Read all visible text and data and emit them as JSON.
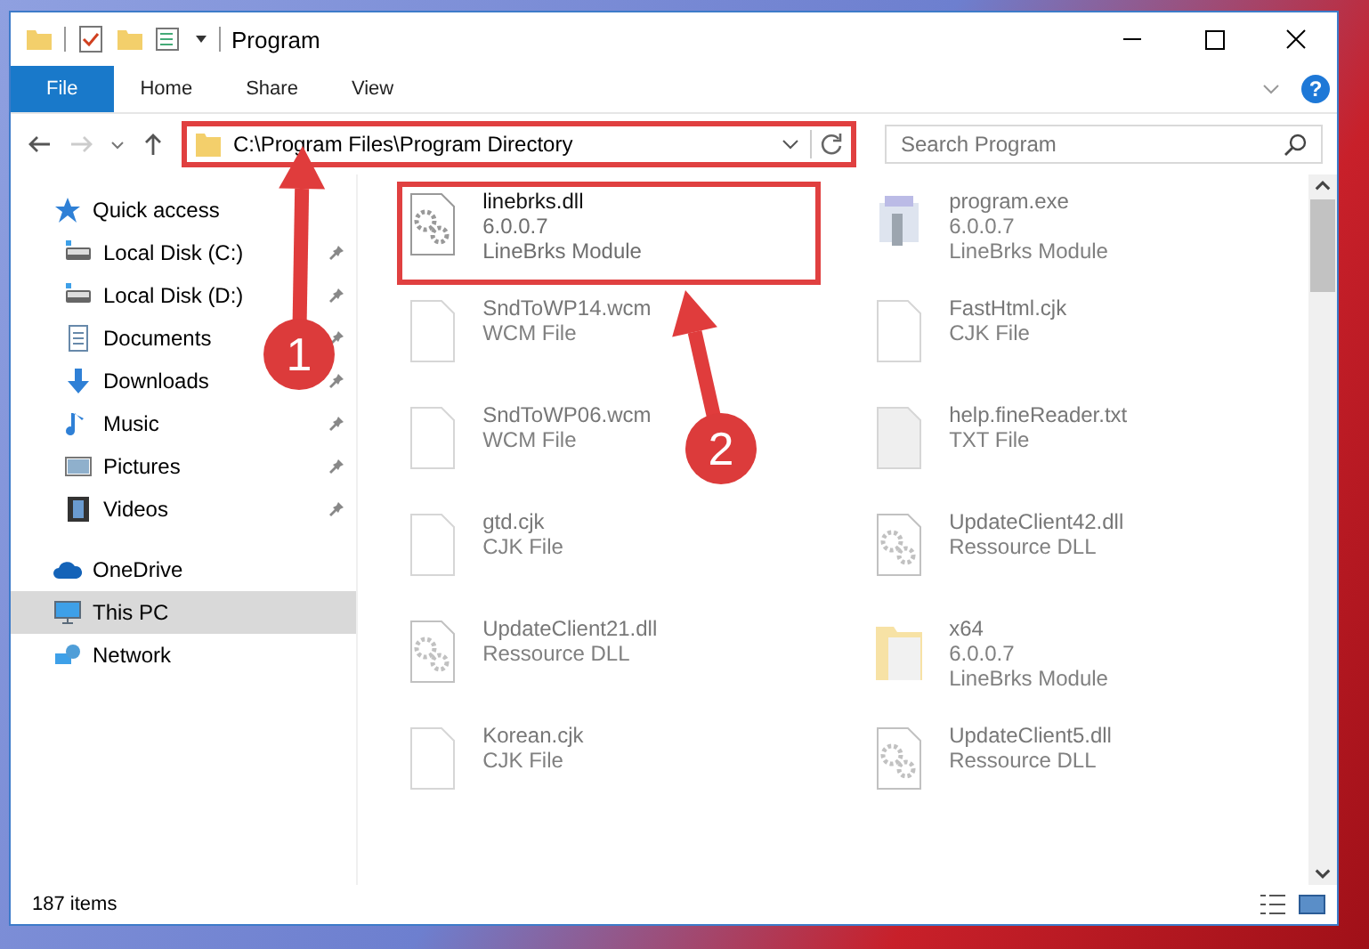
{
  "window": {
    "title": "Program"
  },
  "ribbon_tabs": [
    {
      "label": "File",
      "selected": true
    },
    {
      "label": "Home",
      "selected": false
    },
    {
      "label": "Share",
      "selected": false
    },
    {
      "label": "View",
      "selected": false
    }
  ],
  "help": {
    "label": "?"
  },
  "address": {
    "value": "C:\\Program Files\\Program Directory",
    "highlighted": true
  },
  "search": {
    "placeholder": "Search Program"
  },
  "sidebar": {
    "items": [
      {
        "label": "Quick access",
        "kind": "star",
        "selected": false,
        "children": [
          {
            "label": "Local Disk (C:)",
            "kind": "disk",
            "selected": false,
            "pinned": true
          },
          {
            "label": "Local Disk (D:)",
            "kind": "disk",
            "selected": false,
            "pinned": true
          },
          {
            "label": "Documents",
            "kind": "doc",
            "selected": false,
            "pinned": true
          },
          {
            "label": "Downloads",
            "kind": "download",
            "selected": false,
            "pinned": true
          },
          {
            "label": "Music",
            "kind": "music",
            "selected": false,
            "pinned": true
          },
          {
            "label": "Pictures",
            "kind": "picture",
            "selected": false,
            "pinned": true
          },
          {
            "label": "Videos",
            "kind": "video",
            "selected": false,
            "pinned": true
          }
        ]
      },
      {
        "label": "OneDrive",
        "kind": "cloud",
        "selected": false
      },
      {
        "label": "This PC",
        "kind": "pc",
        "selected": true
      },
      {
        "label": "Network",
        "kind": "network",
        "selected": false
      }
    ]
  },
  "files": [
    {
      "kind": "dll",
      "name": "linebrks.dll",
      "details": [
        "6.0.0.7",
        "LineBrks Module"
      ],
      "dimmed": false,
      "highlighted": true
    },
    {
      "kind": "exe",
      "name": "program.exe",
      "details": [
        "6.0.0.7",
        "LineBrks Module"
      ],
      "dimmed": true,
      "highlighted": false
    },
    {
      "kind": "file",
      "name": "SndToWP14.wcm",
      "details": [
        "WCM File"
      ],
      "dimmed": true,
      "highlighted": false
    },
    {
      "kind": "file",
      "name": "FastHtml.cjk",
      "details": [
        "CJK File"
      ],
      "dimmed": true,
      "highlighted": false
    },
    {
      "kind": "file",
      "name": "SndToWP06.wcm",
      "details": [
        "WCM File"
      ],
      "dimmed": true,
      "highlighted": false
    },
    {
      "kind": "text",
      "name": "help.fineReader.txt",
      "details": [
        "TXT File"
      ],
      "dimmed": true,
      "highlighted": false
    },
    {
      "kind": "file",
      "name": "gtd.cjk",
      "details": [
        "CJK File"
      ],
      "dimmed": true,
      "highlighted": false
    },
    {
      "kind": "dll",
      "name": "UpdateClient42.dll",
      "details": [
        "Ressource DLL"
      ],
      "dimmed": true,
      "highlighted": false
    },
    {
      "kind": "dll",
      "name": "UpdateClient21.dll",
      "details": [
        "Ressource DLL"
      ],
      "dimmed": true,
      "highlighted": false
    },
    {
      "kind": "folder",
      "name": "x64",
      "details": [
        "6.0.0.7",
        "LineBrks Module"
      ],
      "dimmed": true,
      "highlighted": false
    },
    {
      "kind": "file",
      "name": "Korean.cjk",
      "details": [
        "CJK File"
      ],
      "dimmed": true,
      "highlighted": false
    },
    {
      "kind": "dll",
      "name": "UpdateClient5.dll",
      "details": [
        "Ressource DLL"
      ],
      "dimmed": true,
      "highlighted": false
    }
  ],
  "status_bar": {
    "count": "187 items"
  },
  "annotations": [
    {
      "number": "1"
    },
    {
      "number": "2"
    }
  ]
}
